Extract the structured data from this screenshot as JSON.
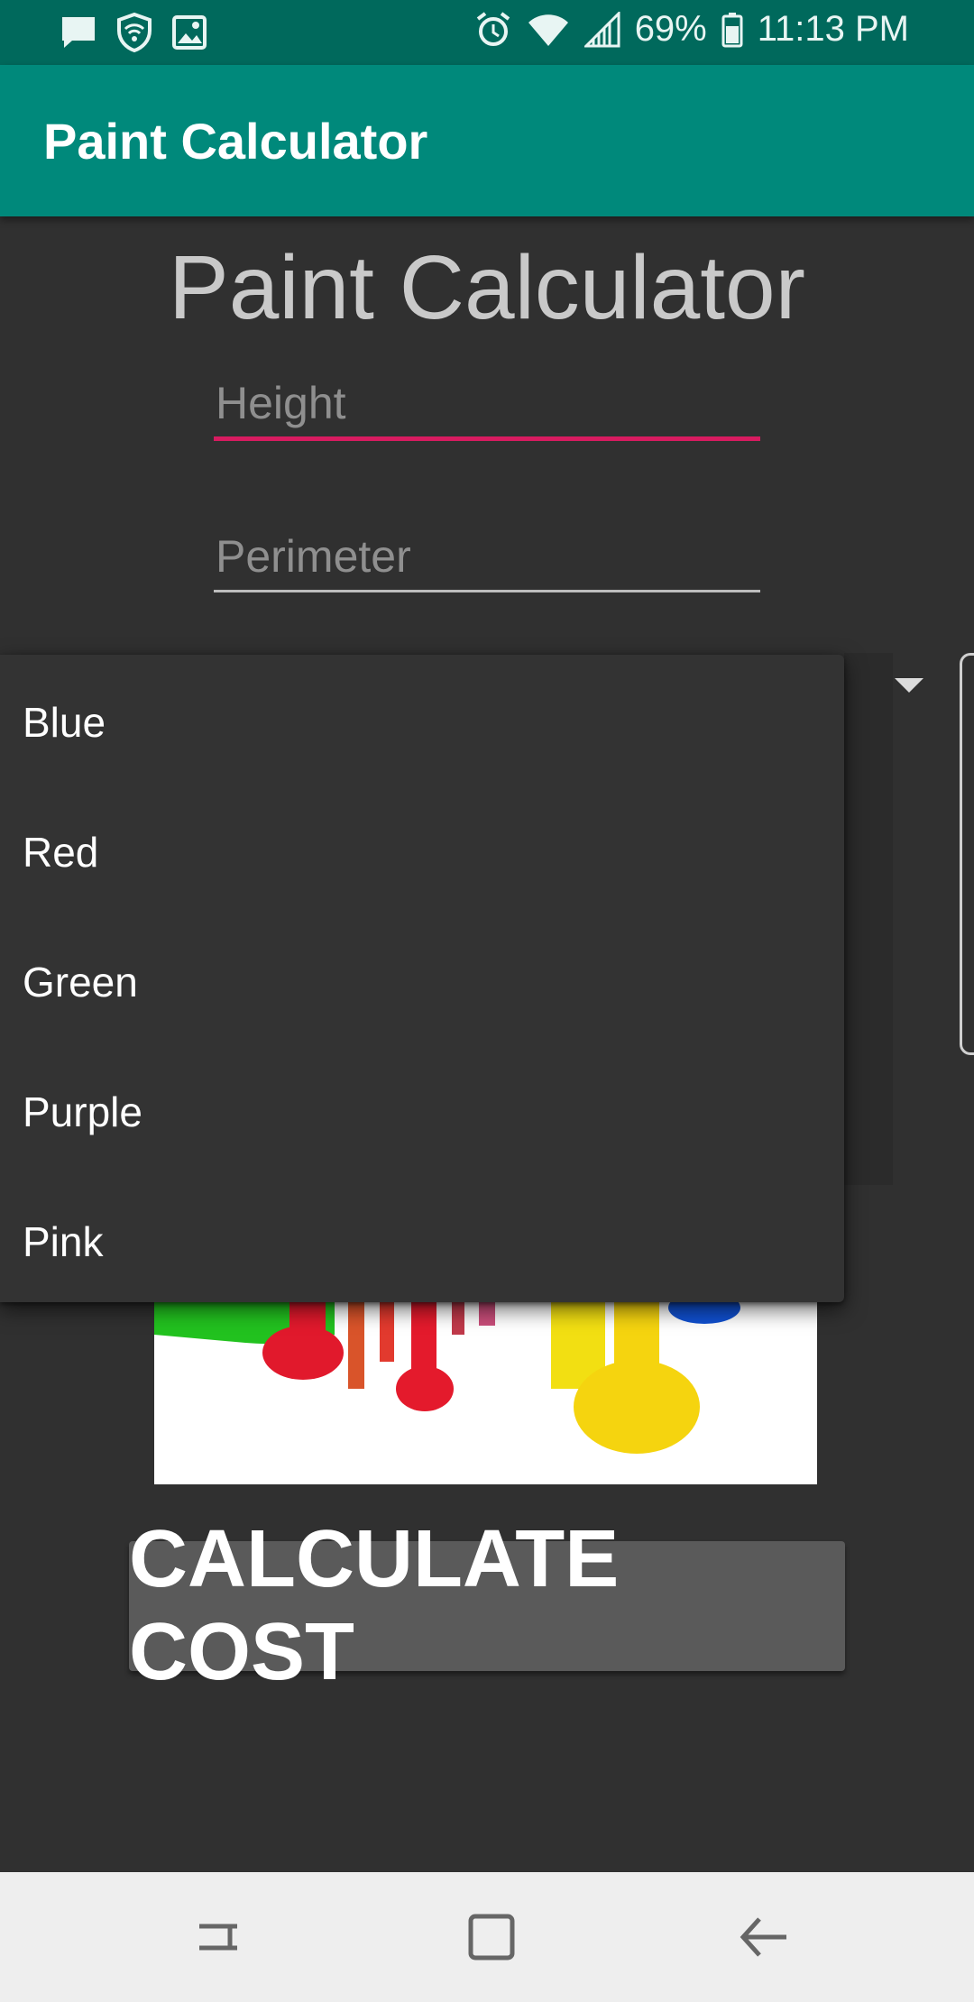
{
  "status_bar": {
    "battery": "69%",
    "time": "11:13 PM",
    "icons_left": [
      "message-icon",
      "shield-wifi-icon",
      "image-icon"
    ],
    "icons_right": [
      "alarm-icon",
      "wifi-icon",
      "signal-icon",
      "battery-icon"
    ]
  },
  "app_bar": {
    "title": "Paint Calculator"
  },
  "main": {
    "heading": "Paint Calculator",
    "height_field": {
      "placeholder": "Height",
      "value": ""
    },
    "perimeter_field": {
      "placeholder": "Perimeter",
      "value": ""
    },
    "calculate_button": "CALCULATE COST"
  },
  "dropdown": {
    "options": [
      "Blue",
      "Red",
      "Green",
      "Purple",
      "Pink"
    ]
  },
  "nav_bar": {
    "icons": [
      "recent-apps-icon",
      "home-icon",
      "back-icon"
    ]
  },
  "colors": {
    "status_bar": "#00695c",
    "app_bar": "#00897b",
    "background": "#303030",
    "focus_accent": "#d81b60",
    "button": "#5a5a5a"
  }
}
